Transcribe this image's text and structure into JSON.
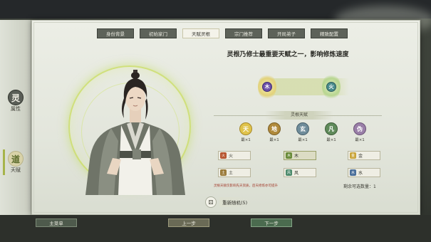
{
  "tabs": [
    {
      "label": "身份背景",
      "active": false
    },
    {
      "label": "初始家门",
      "active": false
    },
    {
      "label": "天赋灵根",
      "active": true
    },
    {
      "label": "宗门推荐",
      "active": false
    },
    {
      "label": "开局弟子",
      "active": false
    },
    {
      "label": "精致配置",
      "active": false
    }
  ],
  "side_tabs": [
    {
      "glyph": "灵",
      "label": "属性"
    },
    {
      "glyph": "道",
      "label": "天赋"
    }
  ],
  "talent": {
    "description": "灵根乃修士最重要天赋之一，影响修炼速度",
    "slot_left": "木",
    "slot_right": "火"
  },
  "elements": {
    "section_title": "灵根天赋",
    "items": [
      {
        "glyph": "天",
        "count": "最×1",
        "color": "#e0c34a"
      },
      {
        "glyph": "地",
        "count": "最×1",
        "color": "#b08a3c"
      },
      {
        "glyph": "玄",
        "count": "最×1",
        "color": "#6f8c9a"
      },
      {
        "glyph": "凡",
        "count": "最×1",
        "color": "#5f8a5a"
      },
      {
        "glyph": "伪",
        "count": "最×1",
        "color": "#9a7fa8"
      }
    ]
  },
  "spirit_roots": {
    "row1": [
      {
        "icon": "火",
        "name": "火",
        "selected": false
      },
      {
        "icon": "木",
        "name": "木",
        "selected": true
      },
      {
        "icon": "金",
        "name": "金",
        "selected": false
      }
    ],
    "row2": [
      {
        "icon": "土",
        "name": "土",
        "selected": false
      },
      {
        "icon": "风",
        "name": "风",
        "selected": false
      },
      {
        "icon": "水",
        "name": "水",
        "selected": false
      }
    ]
  },
  "note": "灵根天赋仅影响先天资质，后天修炼亦可提升",
  "remaining": "剩余可选数量：1",
  "reroll": {
    "label": "重新随机(5)",
    "icon": "dice-icon"
  },
  "buttons": {
    "main": "主菜单",
    "prev": "上一步",
    "next": "下一步"
  },
  "colors": {
    "accent": "#a6b44a",
    "aura": "#c8dc5a",
    "panel": "#e3e6dc"
  }
}
